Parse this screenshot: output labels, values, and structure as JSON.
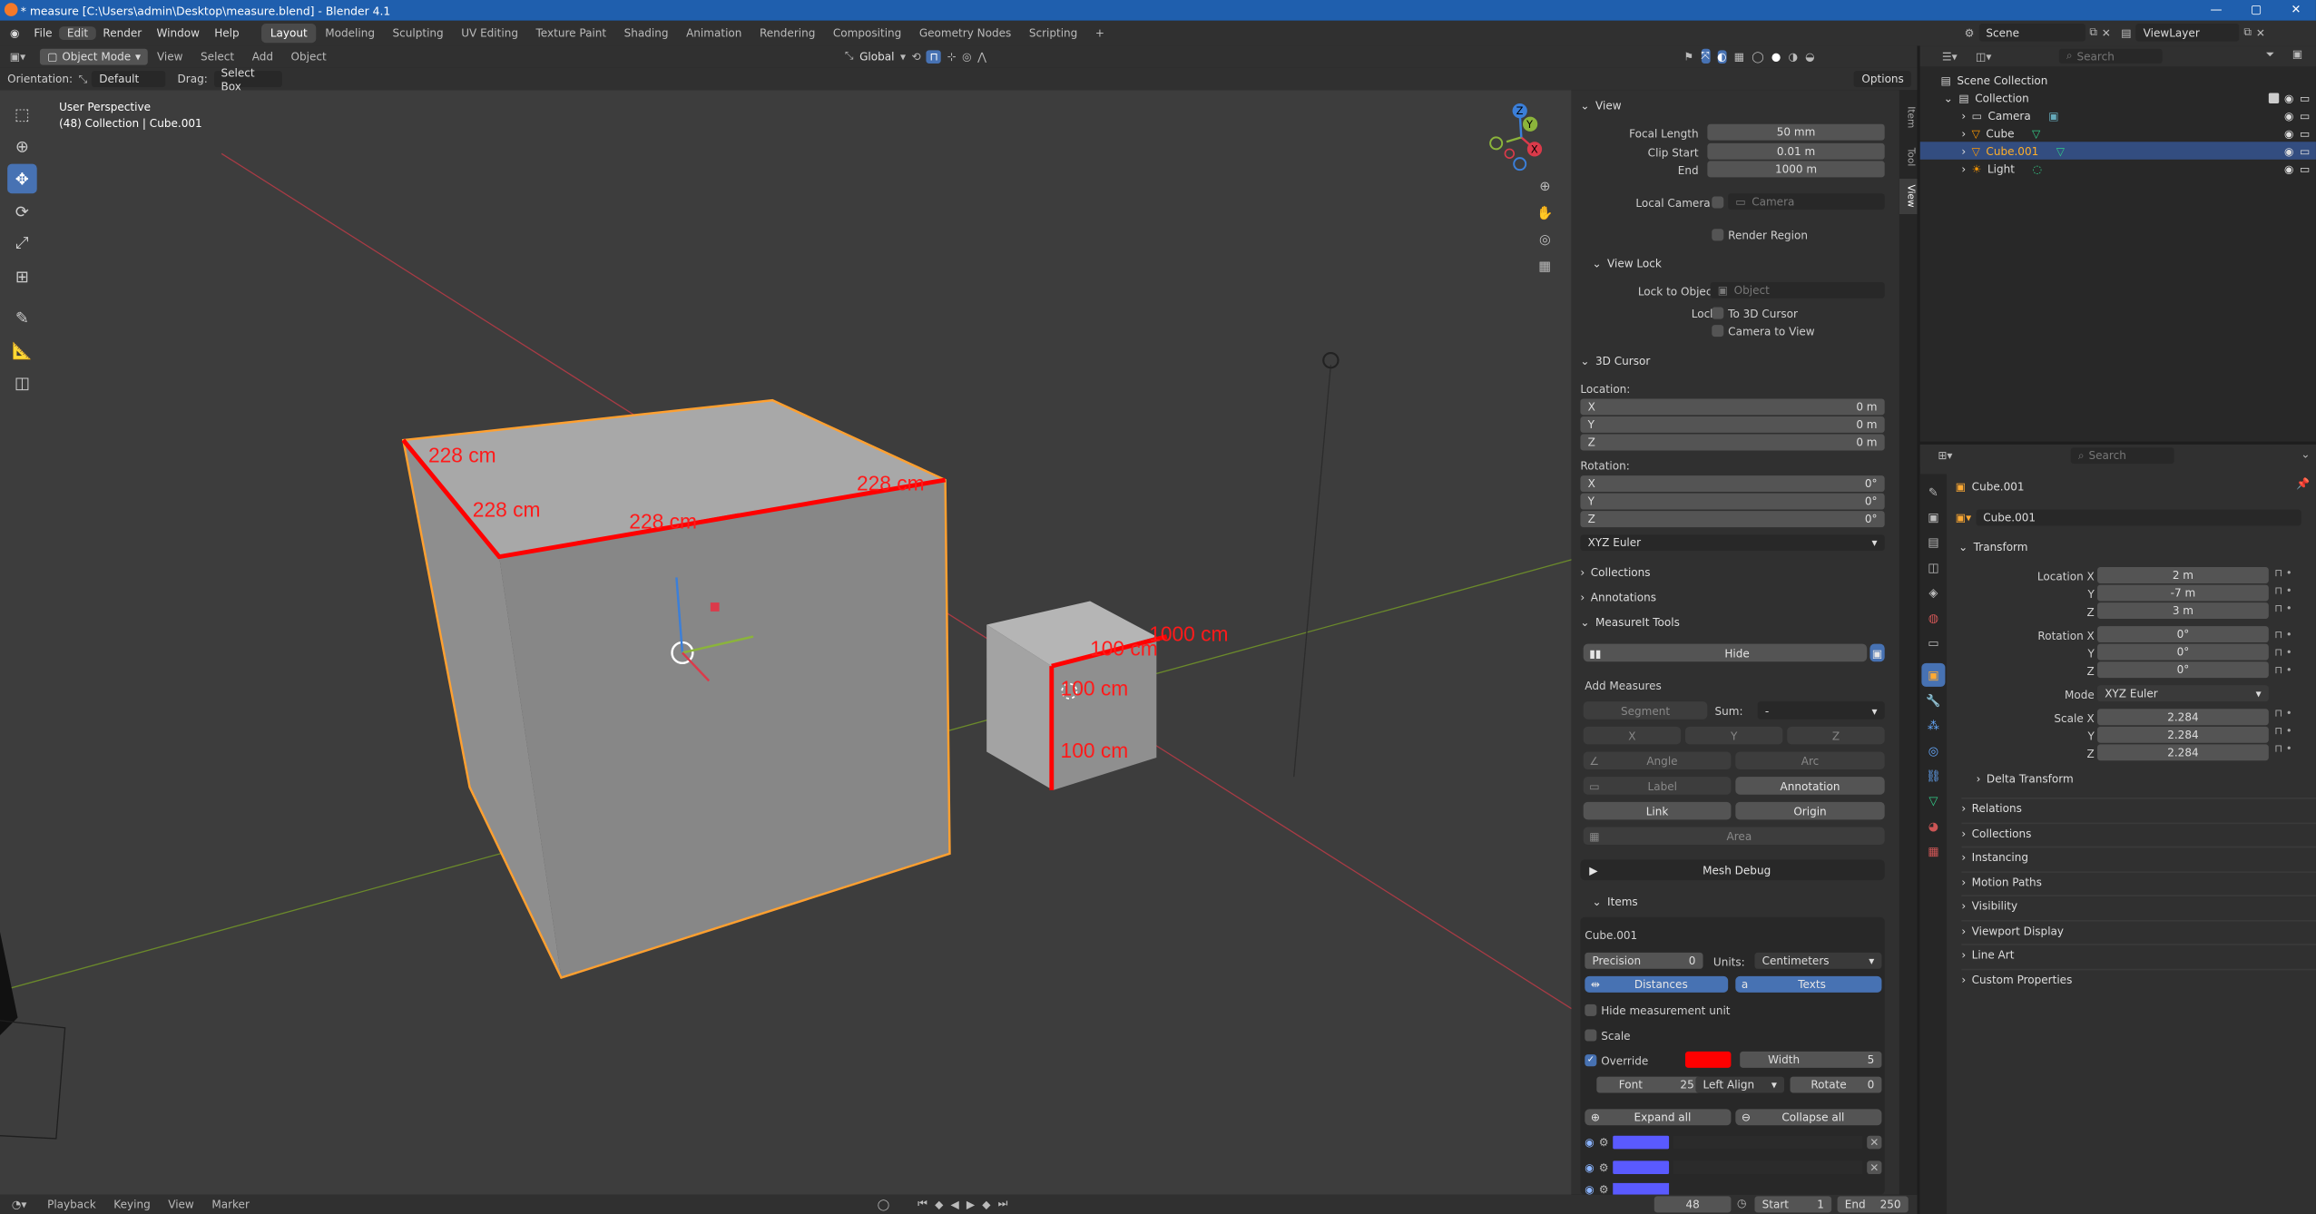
{
  "window": {
    "title": "* measure [C:\\Users\\admin\\Desktop\\measure.blend] - Blender 4.1",
    "min": "—",
    "max": "▢",
    "close": "✕"
  },
  "menu": {
    "items": [
      "File",
      "Edit",
      "Render",
      "Window",
      "Help"
    ]
  },
  "workspaces": [
    "Layout",
    "Modeling",
    "Sculpting",
    "UV Editing",
    "Texture Paint",
    "Shading",
    "Animation",
    "Rendering",
    "Compositing",
    "Geometry Nodes",
    "Scripting"
  ],
  "workspace_add": "+",
  "scene": {
    "name": "Scene",
    "view_layer": "ViewLayer"
  },
  "viewport_header": {
    "mode": "Object Mode",
    "view": "View",
    "select": "Select",
    "add": "Add",
    "object": "Object",
    "transform": "Global"
  },
  "tool_header": {
    "orientation_label": "Orientation:",
    "orientation": "Default",
    "drag_label": "Drag:",
    "drag": "Select Box",
    "options": "Options"
  },
  "viewport": {
    "perspective": "User Perspective",
    "info": "(48) Collection | Cube.001"
  },
  "gizmo": {
    "x": "X",
    "y": "Y",
    "z": "Z"
  },
  "measure_labels": [
    "228 cm",
    "228 cm",
    "228 cm",
    "228 cm",
    "100 cm",
    "100 cm",
    "100 cm",
    "1000 cm"
  ],
  "sidebar": {
    "tabs": [
      "Item",
      "Tool",
      "View"
    ],
    "view": {
      "title": "View",
      "focal_length_label": "Focal Length",
      "focal_length": "50 mm",
      "clip_start_label": "Clip Start",
      "clip_start": "0.01 m",
      "end_label": "End",
      "end": "1000 m",
      "local_camera_label": "Local Camera",
      "local_camera_placeholder": "Camera",
      "render_region": "Render Region"
    },
    "view_lock": {
      "title": "View Lock",
      "lock_to_object_label": "Lock to Object",
      "object_placeholder": "Object",
      "lock_label": "Lock",
      "to_3d_cursor": "To 3D Cursor",
      "camera_to_view": "Camera to View"
    },
    "cursor": {
      "title": "3D Cursor",
      "location_label": "Location:",
      "x": "0 m",
      "y": "0 m",
      "z": "0 m",
      "rotation_label": "Rotation:",
      "rx": "0°",
      "ry": "0°",
      "rz": "0°",
      "mode": "XYZ Euler"
    },
    "collections": "Collections",
    "annotations": "Annotations",
    "measureit": {
      "title": "MeasureIt Tools",
      "hide": "Hide",
      "add_measures": "Add Measures",
      "segment": "Segment",
      "sum_label": "Sum:",
      "sum": "-",
      "x": "X",
      "y": "Y",
      "z": "Z",
      "angle": "Angle",
      "arc": "Arc",
      "label": "Label",
      "annotation": "Annotation",
      "link": "Link",
      "origin": "Origin",
      "area": "Area",
      "mesh_debug": "Mesh Debug",
      "items_title": "Items",
      "object": "Cube.001",
      "precision_label": "Precision",
      "precision": "0",
      "units_label": "Units:",
      "units": "Centimeters",
      "distances": "Distances",
      "texts": "Texts",
      "hide_unit": "Hide measurement unit",
      "scale": "Scale",
      "override": "Override",
      "override_color": "#ff0000",
      "width_label": "Width",
      "width": "5",
      "font_label": "Font",
      "font": "25",
      "align": "Left Align",
      "rotate_label": "Rotate",
      "rotate": "0",
      "expand_all": "Expand all",
      "collapse_all": "Collapse all",
      "bar_color": "#5a5aff"
    }
  },
  "timeline": {
    "playback": "Playback",
    "keying": "Keying",
    "view": "View",
    "marker": "Marker",
    "frame": "48",
    "start_label": "Start",
    "start": "1",
    "end_label": "End",
    "end": "250"
  },
  "outliner": {
    "search_placeholder": "Search",
    "scene_collection": "Scene Collection",
    "collection": "Collection",
    "items": [
      {
        "name": "Camera",
        "icon": "camera-icon",
        "selected": false
      },
      {
        "name": "Cube",
        "icon": "mesh-icon",
        "selected": false
      },
      {
        "name": "Cube.001",
        "icon": "mesh-icon",
        "selected": true
      },
      {
        "name": "Light",
        "icon": "light-icon",
        "selected": false
      }
    ]
  },
  "properties": {
    "search_placeholder": "Search",
    "object_name": "Cube.001",
    "object_name_field": "Cube.001",
    "transform_title": "Transform",
    "location_x_label": "Location X",
    "location_x": "2 m",
    "y_label": "Y",
    "location_y": "-7 m",
    "z_label": "Z",
    "location_z": "3 m",
    "rotation_x_label": "Rotation X",
    "rotation_x": "0°",
    "rotation_y": "0°",
    "rotation_z": "0°",
    "mode_label": "Mode",
    "mode": "XYZ Euler",
    "scale_x_label": "Scale X",
    "scale_x": "2.284",
    "scale_y": "2.284",
    "scale_z": "2.284",
    "delta_transform": "Delta Transform",
    "sections": [
      "Relations",
      "Collections",
      "Instancing",
      "Motion Paths",
      "Visibility",
      "Viewport Display",
      "Line Art",
      "Custom Properties"
    ]
  },
  "colors": {
    "accent": "#4772b3",
    "selection": "#ffa030",
    "measure": "#ff0000",
    "axis_x": "#db3a4a",
    "axis_y": "#8bb43b",
    "axis_z": "#3b7fd9"
  }
}
